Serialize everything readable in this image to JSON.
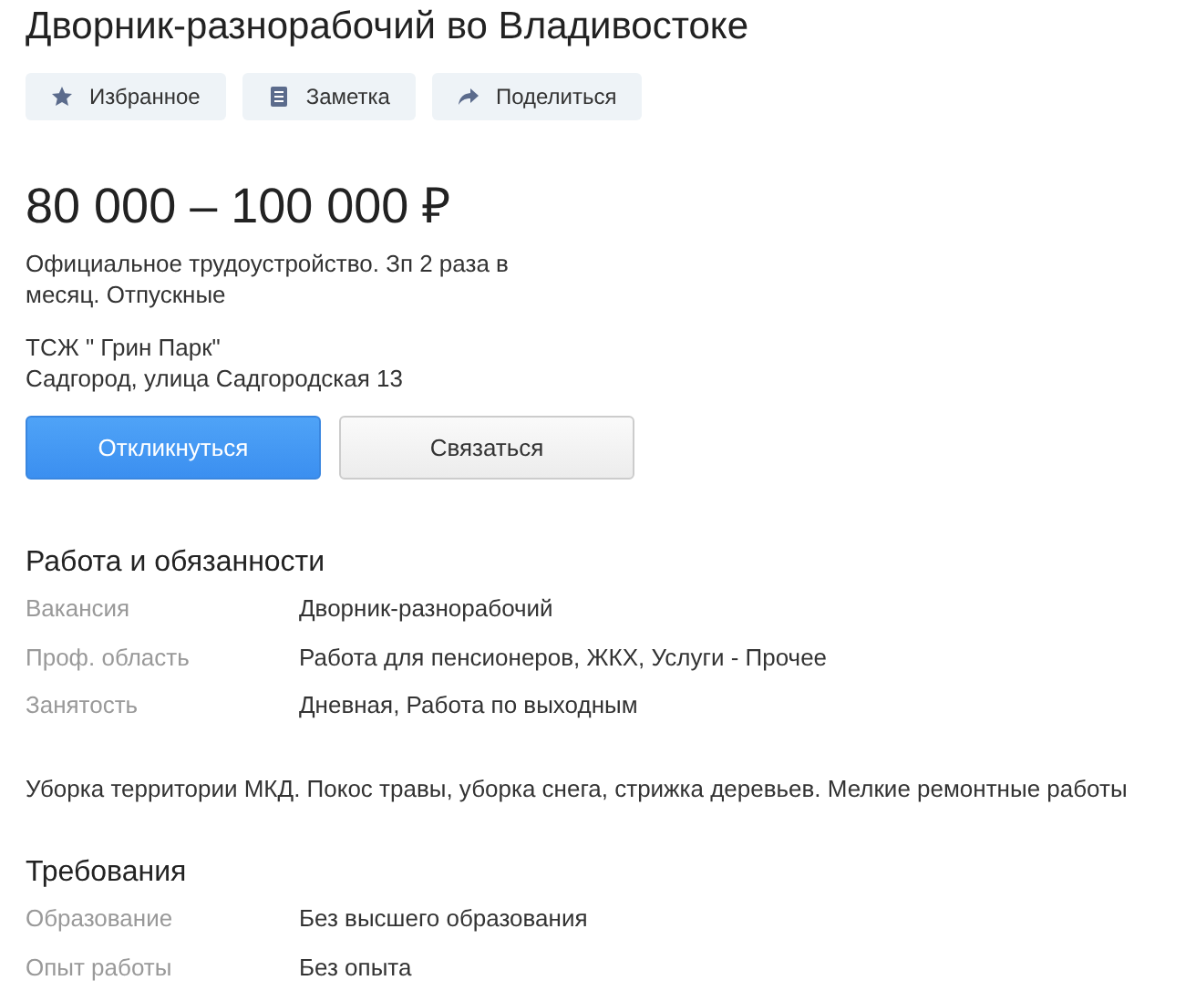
{
  "title": "Дворник-разнорабочий во Владивостоке",
  "actions": [
    {
      "kind": "star",
      "label": "Избранное"
    },
    {
      "kind": "note",
      "label": "Заметка"
    },
    {
      "kind": "share",
      "label": "Поделиться"
    }
  ],
  "salary": "80 000 – 100 000 ₽",
  "salary_note": "Официальное трудоустройство. Зп 2 раза в месяц. Отпускные",
  "company": "ТСЖ \" Грин Парк\"",
  "address": "Садгород, улица Садгородская 13",
  "buttons": [
    {
      "kind": "primary",
      "label": "Откликнуться"
    },
    {
      "kind": "secondary",
      "label": "Связаться"
    }
  ],
  "sections": [
    {
      "title": "Работа и обязанности",
      "rows": [
        {
          "label": "Вакансия",
          "value": "Дворник-разнорабочий"
        },
        {
          "label": "Проф. область",
          "value": "Работа для пенсионеров, ЖКХ, Услуги - Прочее"
        },
        {
          "label": "Занятость",
          "value": "Дневная, Работа по выходным"
        }
      ],
      "description": "Уборка территории МКД. Покос травы, уборка снега, стрижка деревьев. Мелкие ремонтные работы"
    },
    {
      "title": "Требования",
      "rows": [
        {
          "label": "Образование",
          "value": "Без высшего образования"
        },
        {
          "label": "Опыт работы",
          "value": "Без опыта"
        }
      ]
    }
  ]
}
